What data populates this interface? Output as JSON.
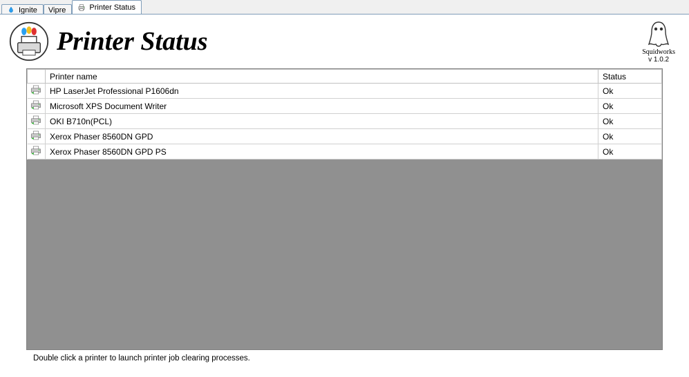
{
  "tabs": [
    {
      "label": "Ignite",
      "active": false
    },
    {
      "label": "Vipre",
      "active": false
    },
    {
      "label": "Printer Status",
      "active": true
    }
  ],
  "header": {
    "title": "Printer Status"
  },
  "brand": {
    "name": "Squidworks",
    "version": "v 1.0.2"
  },
  "grid": {
    "columns": {
      "icon": "",
      "name": "Printer name",
      "status": "Status"
    },
    "rows": [
      {
        "name": "HP LaserJet Professional P1606dn",
        "status": "Ok"
      },
      {
        "name": "Microsoft XPS Document Writer",
        "status": "Ok"
      },
      {
        "name": "OKI B710n(PCL)",
        "status": "Ok"
      },
      {
        "name": "Xerox Phaser 8560DN GPD",
        "status": "Ok"
      },
      {
        "name": "Xerox Phaser 8560DN GPD PS",
        "status": "Ok"
      }
    ]
  },
  "hint": "Double click a printer to launch printer job clearing processes."
}
